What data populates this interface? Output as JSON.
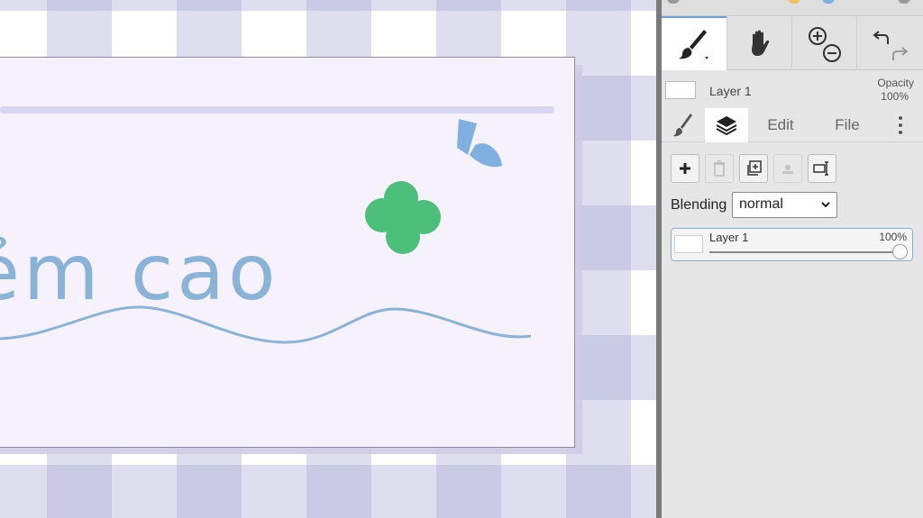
{
  "canvas": {
    "visible_text": "ẻm cao"
  },
  "toolbar": {
    "tools": [
      {
        "name": "brush-tool",
        "icon": "paintbrush-icon",
        "active": true
      },
      {
        "name": "hand-tool",
        "icon": "hand-icon"
      },
      {
        "name": "zoom-tool",
        "icon": "zoom-in-out-icon"
      },
      {
        "name": "undo-redo",
        "icon": "undo-redo-icon"
      }
    ]
  },
  "layer_info": {
    "layer_name": "Layer 1",
    "opacity_label": "Opacity",
    "opacity_value": "100%"
  },
  "tabs": {
    "brush_icon": "paintbrush-icon",
    "layers_icon": "layers-icon",
    "edit": "Edit",
    "file": "File",
    "more_icon": "more-vertical-icon"
  },
  "layers_panel": {
    "blending_label": "Blending",
    "blending_value": "normal",
    "layers": [
      {
        "name": "Layer 1",
        "opacity": "100%",
        "opacity_fraction": 1.0
      }
    ]
  },
  "colors": {
    "accent_blue": "#6f9fe0",
    "card_text": "#8ab3d8",
    "clover_green": "#4cbf7a",
    "card_bg": "#f6f2fb"
  }
}
